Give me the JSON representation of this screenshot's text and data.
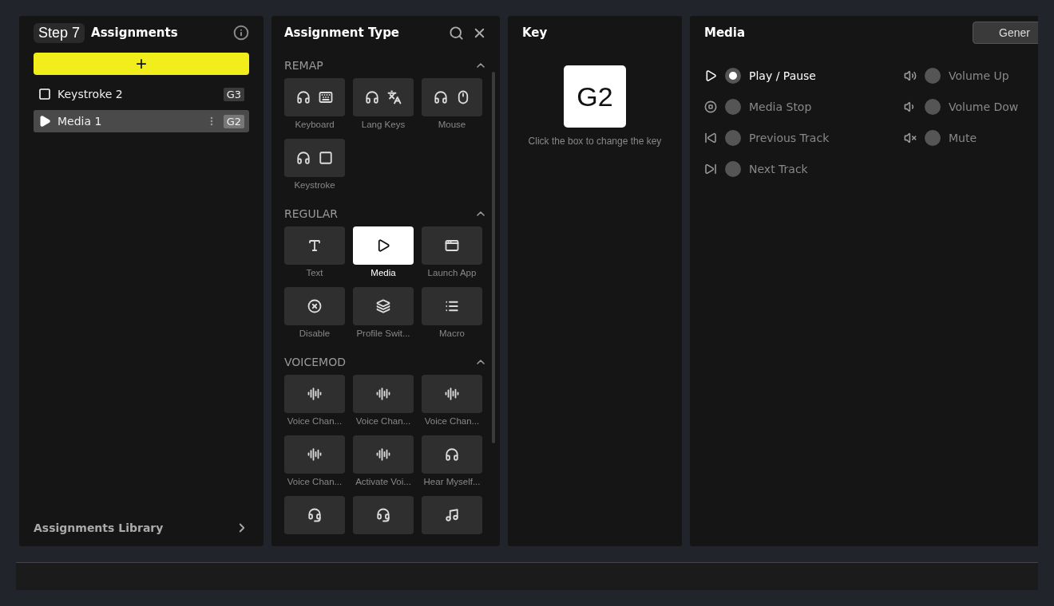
{
  "step_badge": "Step 7",
  "assignments": {
    "title": "Assignments",
    "add_button": "+",
    "items": [
      {
        "label": "Keystroke 2",
        "key": "G3",
        "selected": false
      },
      {
        "label": "Media 1",
        "key": "G2",
        "selected": true
      }
    ],
    "library": "Assignments Library"
  },
  "assignment_type": {
    "title": "Assignment Type",
    "sections": [
      {
        "title": "REMAP",
        "expanded": true,
        "tiles": [
          {
            "label": "Keyboard",
            "selected": false
          },
          {
            "label": "Lang Keys",
            "selected": false
          },
          {
            "label": "Mouse",
            "selected": false
          },
          {
            "label": "Keystroke",
            "selected": false
          }
        ]
      },
      {
        "title": "REGULAR",
        "expanded": true,
        "tiles": [
          {
            "label": "Text",
            "selected": false
          },
          {
            "label": "Media",
            "selected": true
          },
          {
            "label": "Launch App",
            "selected": false
          },
          {
            "label": "Disable",
            "selected": false
          },
          {
            "label": "Profile Swit...",
            "selected": false
          },
          {
            "label": "Macro",
            "selected": false
          }
        ]
      },
      {
        "title": "VOICEMOD",
        "expanded": true,
        "tiles": [
          {
            "label": "Voice Chan...",
            "selected": false
          },
          {
            "label": "Voice Chan...",
            "selected": false
          },
          {
            "label": "Voice Chan...",
            "selected": false
          },
          {
            "label": "Voice Chan...",
            "selected": false
          },
          {
            "label": "Activate Voi...",
            "selected": false
          },
          {
            "label": "Hear Myself...",
            "selected": false
          },
          {
            "selected": false
          },
          {
            "selected": false
          },
          {
            "selected": false
          }
        ]
      }
    ]
  },
  "key": {
    "title": "Key",
    "value": "G2",
    "hint": "Click the box to change the key"
  },
  "media": {
    "title": "Media",
    "button": "Gener",
    "options": [
      {
        "label": "Play / Pause",
        "selected": true
      },
      {
        "label": "Volume Up",
        "selected": false
      },
      {
        "label": "Media Stop",
        "selected": false
      },
      {
        "label": "Volume Dow",
        "selected": false
      },
      {
        "label": "Previous Track",
        "selected": false
      },
      {
        "label": "Mute",
        "selected": false
      },
      {
        "label": "Next Track",
        "selected": false
      }
    ]
  }
}
